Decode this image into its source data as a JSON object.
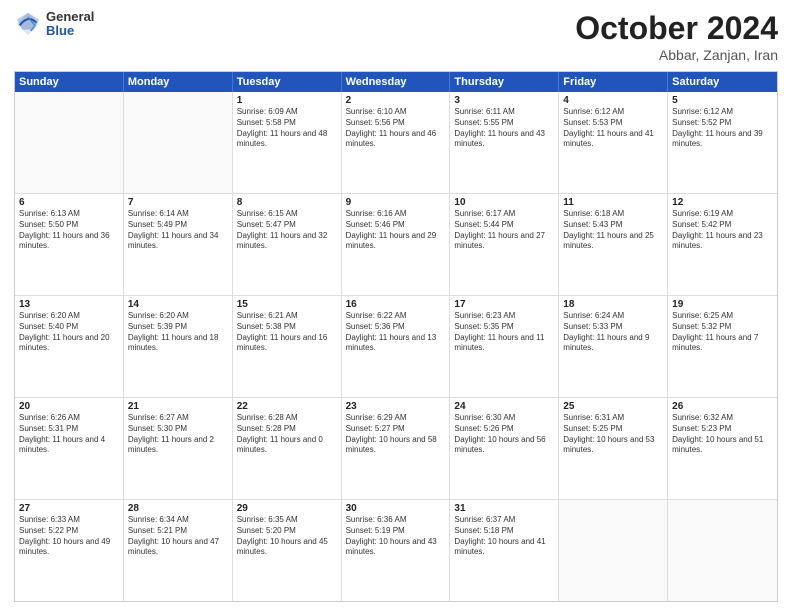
{
  "header": {
    "logo": {
      "general": "General",
      "blue": "Blue"
    },
    "title": "October 2024",
    "location": "Abbar, Zanjan, Iran"
  },
  "days_of_week": [
    "Sunday",
    "Monday",
    "Tuesday",
    "Wednesday",
    "Thursday",
    "Friday",
    "Saturday"
  ],
  "weeks": [
    [
      {
        "day": "",
        "info": "",
        "empty": true
      },
      {
        "day": "",
        "info": "",
        "empty": true
      },
      {
        "day": "1",
        "info": "Sunrise: 6:09 AM\nSunset: 5:58 PM\nDaylight: 11 hours and 48 minutes.",
        "empty": false
      },
      {
        "day": "2",
        "info": "Sunrise: 6:10 AM\nSunset: 5:56 PM\nDaylight: 11 hours and 46 minutes.",
        "empty": false
      },
      {
        "day": "3",
        "info": "Sunrise: 6:11 AM\nSunset: 5:55 PM\nDaylight: 11 hours and 43 minutes.",
        "empty": false
      },
      {
        "day": "4",
        "info": "Sunrise: 6:12 AM\nSunset: 5:53 PM\nDaylight: 11 hours and 41 minutes.",
        "empty": false
      },
      {
        "day": "5",
        "info": "Sunrise: 6:12 AM\nSunset: 5:52 PM\nDaylight: 11 hours and 39 minutes.",
        "empty": false
      }
    ],
    [
      {
        "day": "6",
        "info": "Sunrise: 6:13 AM\nSunset: 5:50 PM\nDaylight: 11 hours and 36 minutes.",
        "empty": false
      },
      {
        "day": "7",
        "info": "Sunrise: 6:14 AM\nSunset: 5:49 PM\nDaylight: 11 hours and 34 minutes.",
        "empty": false
      },
      {
        "day": "8",
        "info": "Sunrise: 6:15 AM\nSunset: 5:47 PM\nDaylight: 11 hours and 32 minutes.",
        "empty": false
      },
      {
        "day": "9",
        "info": "Sunrise: 6:16 AM\nSunset: 5:46 PM\nDaylight: 11 hours and 29 minutes.",
        "empty": false
      },
      {
        "day": "10",
        "info": "Sunrise: 6:17 AM\nSunset: 5:44 PM\nDaylight: 11 hours and 27 minutes.",
        "empty": false
      },
      {
        "day": "11",
        "info": "Sunrise: 6:18 AM\nSunset: 5:43 PM\nDaylight: 11 hours and 25 minutes.",
        "empty": false
      },
      {
        "day": "12",
        "info": "Sunrise: 6:19 AM\nSunset: 5:42 PM\nDaylight: 11 hours and 23 minutes.",
        "empty": false
      }
    ],
    [
      {
        "day": "13",
        "info": "Sunrise: 6:20 AM\nSunset: 5:40 PM\nDaylight: 11 hours and 20 minutes.",
        "empty": false
      },
      {
        "day": "14",
        "info": "Sunrise: 6:20 AM\nSunset: 5:39 PM\nDaylight: 11 hours and 18 minutes.",
        "empty": false
      },
      {
        "day": "15",
        "info": "Sunrise: 6:21 AM\nSunset: 5:38 PM\nDaylight: 11 hours and 16 minutes.",
        "empty": false
      },
      {
        "day": "16",
        "info": "Sunrise: 6:22 AM\nSunset: 5:36 PM\nDaylight: 11 hours and 13 minutes.",
        "empty": false
      },
      {
        "day": "17",
        "info": "Sunrise: 6:23 AM\nSunset: 5:35 PM\nDaylight: 11 hours and 11 minutes.",
        "empty": false
      },
      {
        "day": "18",
        "info": "Sunrise: 6:24 AM\nSunset: 5:33 PM\nDaylight: 11 hours and 9 minutes.",
        "empty": false
      },
      {
        "day": "19",
        "info": "Sunrise: 6:25 AM\nSunset: 5:32 PM\nDaylight: 11 hours and 7 minutes.",
        "empty": false
      }
    ],
    [
      {
        "day": "20",
        "info": "Sunrise: 6:26 AM\nSunset: 5:31 PM\nDaylight: 11 hours and 4 minutes.",
        "empty": false
      },
      {
        "day": "21",
        "info": "Sunrise: 6:27 AM\nSunset: 5:30 PM\nDaylight: 11 hours and 2 minutes.",
        "empty": false
      },
      {
        "day": "22",
        "info": "Sunrise: 6:28 AM\nSunset: 5:28 PM\nDaylight: 11 hours and 0 minutes.",
        "empty": false
      },
      {
        "day": "23",
        "info": "Sunrise: 6:29 AM\nSunset: 5:27 PM\nDaylight: 10 hours and 58 minutes.",
        "empty": false
      },
      {
        "day": "24",
        "info": "Sunrise: 6:30 AM\nSunset: 5:26 PM\nDaylight: 10 hours and 56 minutes.",
        "empty": false
      },
      {
        "day": "25",
        "info": "Sunrise: 6:31 AM\nSunset: 5:25 PM\nDaylight: 10 hours and 53 minutes.",
        "empty": false
      },
      {
        "day": "26",
        "info": "Sunrise: 6:32 AM\nSunset: 5:23 PM\nDaylight: 10 hours and 51 minutes.",
        "empty": false
      }
    ],
    [
      {
        "day": "27",
        "info": "Sunrise: 6:33 AM\nSunset: 5:22 PM\nDaylight: 10 hours and 49 minutes.",
        "empty": false
      },
      {
        "day": "28",
        "info": "Sunrise: 6:34 AM\nSunset: 5:21 PM\nDaylight: 10 hours and 47 minutes.",
        "empty": false
      },
      {
        "day": "29",
        "info": "Sunrise: 6:35 AM\nSunset: 5:20 PM\nDaylight: 10 hours and 45 minutes.",
        "empty": false
      },
      {
        "day": "30",
        "info": "Sunrise: 6:36 AM\nSunset: 5:19 PM\nDaylight: 10 hours and 43 minutes.",
        "empty": false
      },
      {
        "day": "31",
        "info": "Sunrise: 6:37 AM\nSunset: 5:18 PM\nDaylight: 10 hours and 41 minutes.",
        "empty": false
      },
      {
        "day": "",
        "info": "",
        "empty": true
      },
      {
        "day": "",
        "info": "",
        "empty": true
      }
    ]
  ]
}
